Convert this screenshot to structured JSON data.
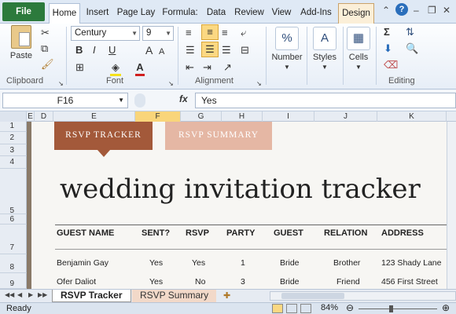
{
  "ribbon_tabs": {
    "file": "File",
    "home": "Home",
    "insert": "Insert",
    "page_layout": "Page Lay",
    "formulas": "Formula:",
    "data": "Data",
    "review": "Review",
    "view": "View",
    "addins": "Add-Ins",
    "design": "Design"
  },
  "ribbon": {
    "paste": "Paste",
    "clipboard": "Clipboard",
    "font_name": "Century",
    "font_size": "9",
    "bold": "B",
    "italic": "I",
    "underline": "U",
    "font_group": "Font",
    "alignment_group": "Alignment",
    "number": "Number",
    "number_icon": "%",
    "styles": "Styles",
    "cells": "Cells",
    "editing": "Editing",
    "sum": "Σ"
  },
  "formula_bar": {
    "name_box": "F16",
    "fx": "fx",
    "value": "Yes"
  },
  "columns": [
    "E",
    "D",
    "E",
    "F",
    "G",
    "H",
    "I",
    "J",
    "K"
  ],
  "rows": [
    "1",
    "2",
    "3",
    "4",
    "5",
    "6",
    "7",
    "8",
    "9"
  ],
  "sheet": {
    "rsvp_tracker": "RSVP TRACKER",
    "rsvp_summary": "RSVP SUMMARY",
    "title": "wedding invitation tracker",
    "headers": [
      "GUEST NAME",
      "SENT?",
      "RSVP",
      "PARTY",
      "GUEST",
      "RELATION",
      "ADDRESS"
    ],
    "rows": [
      [
        "Benjamin Gay",
        "Yes",
        "Yes",
        "1",
        "Bride",
        "Brother",
        "123 Shady Lane"
      ],
      [
        "Ofer Daliot",
        "Yes",
        "No",
        "3",
        "Bride",
        "Friend",
        "456 First Street"
      ]
    ]
  },
  "sheet_tabs": {
    "active": "RSVP Tracker",
    "other": "RSVP Summary"
  },
  "status": {
    "ready": "Ready",
    "zoom": "84%"
  },
  "colors": {
    "file_tab": "#2c7a3c",
    "tracker_tab": "#a3593a",
    "summary_tab": "#e5b7a4",
    "selected_col": "#f9d57a"
  }
}
